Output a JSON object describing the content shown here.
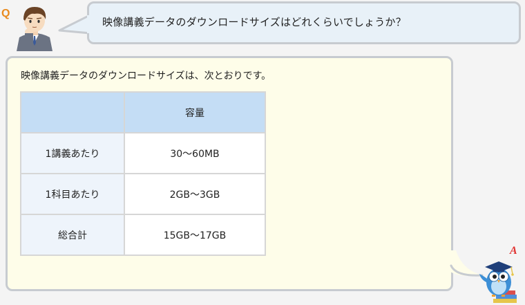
{
  "question": {
    "marker": "Q",
    "text": "映像講義データのダウンロードサイズはどれくらいでしょうか？"
  },
  "answer": {
    "marker": "A",
    "text": "映像講義データのダウンロードサイズは、次とおりです。",
    "table": {
      "header": [
        "",
        "容量"
      ],
      "rows": [
        {
          "label": "1講義あたり",
          "value": "30～60MB"
        },
        {
          "label": "1科目あたり",
          "value": "2GB～3GB"
        },
        {
          "label": "総合計",
          "value": "15GB～17GB"
        }
      ]
    }
  },
  "icons": {
    "person": "thinking-man-icon",
    "owl": "graduate-owl-icon"
  },
  "colors": {
    "question_bg": "#e8f1f8",
    "answer_bg": "#fefde9",
    "table_header_bg": "#c4ddf5",
    "table_rowhead_bg": "#eef4fb",
    "q_marker": "#e98a1d",
    "a_marker": "#e0322f"
  }
}
